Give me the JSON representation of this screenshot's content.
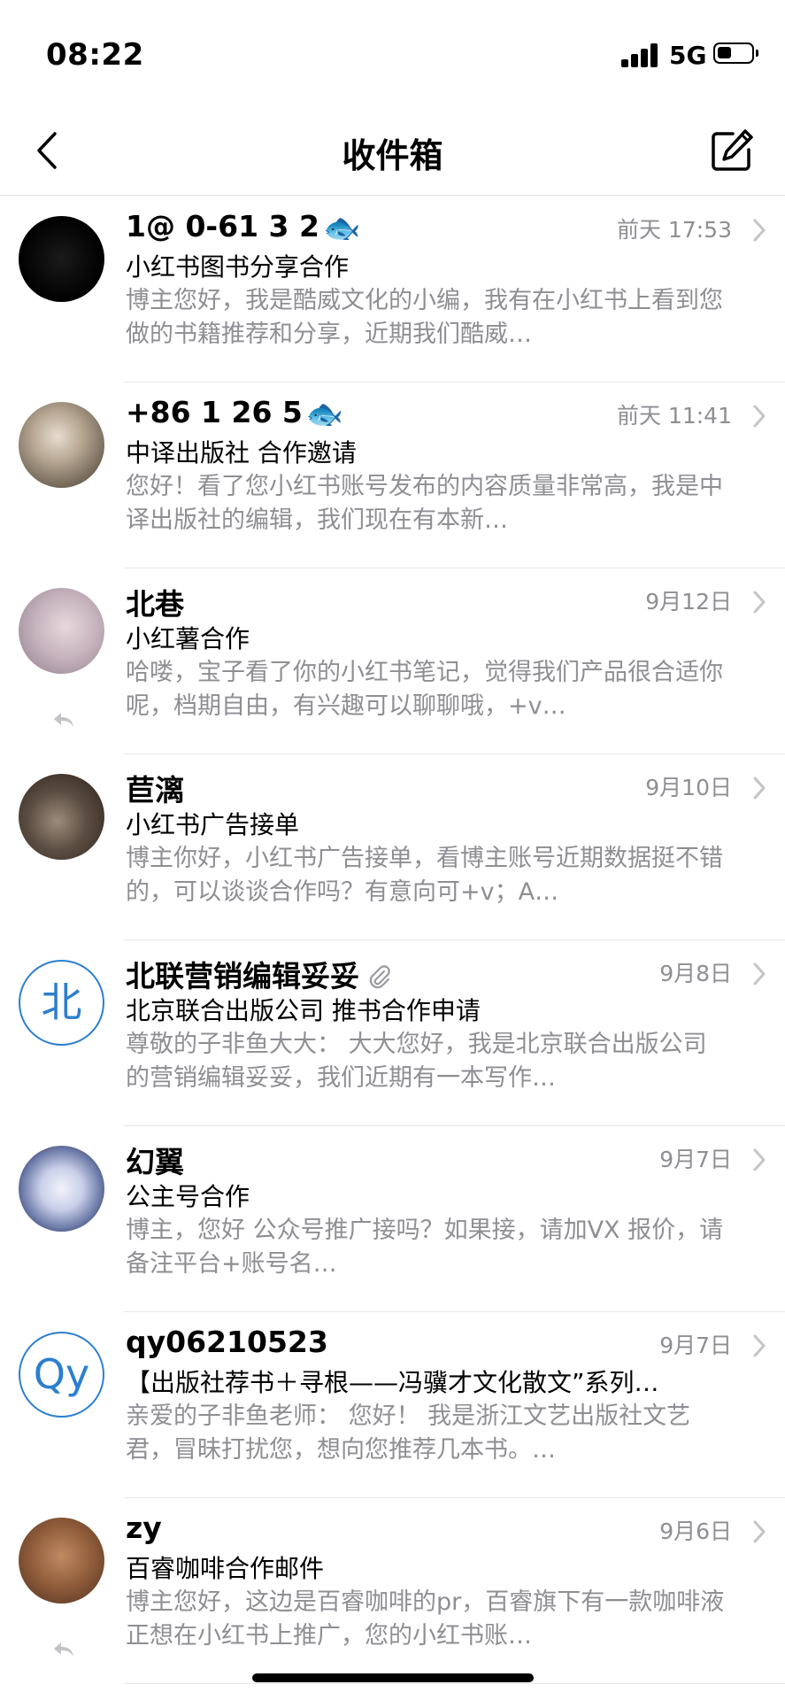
{
  "status_bar": {
    "time": "08:22",
    "network": "5G"
  },
  "nav": {
    "title": "收件箱"
  },
  "icons": {
    "back": "chevron-left-icon",
    "compose": "compose-icon",
    "reply": "reply-icon",
    "attachment": "paperclip-icon",
    "row_arrow": "chevron-right-icon"
  },
  "colors": {
    "accent": "#2c7fd0",
    "secondary_text": "#8e8e93"
  },
  "mails": [
    {
      "sender": "1@ 0-61 3 2",
      "sender_emoji": "🐟",
      "date": "前天 17:53",
      "subject": "小红书图书分享合作",
      "preview": "博主您好，我是酷威文化的小编，我有在小红书上看到您做的书籍推荐和分享，近期我们酷威…",
      "avatar": "black-photo",
      "replied": false,
      "attachment": false
    },
    {
      "sender": "+86 1 26 5",
      "sender_emoji": "🐟",
      "date": "前天 11:41",
      "subject": "中译出版社 合作邀请",
      "preview": "您好！看了您小红书账号发布的内容质量非常高，我是中译出版社的编辑，我们现在有本新…",
      "avatar": "photo-portrait",
      "replied": false,
      "attachment": false
    },
    {
      "sender": "北巷",
      "sender_emoji": "",
      "date": "9月12日",
      "subject": "小红薯合作",
      "preview": "哈喽，宝子看了你的小红书笔记，觉得我们产品很合适你呢，档期自由，有兴趣可以聊聊哦，+v…",
      "avatar": "photo-anime",
      "replied": true,
      "attachment": false
    },
    {
      "sender": "苣漓",
      "sender_emoji": "",
      "date": "9月10日",
      "subject": "小红书广告接单",
      "preview": "博主你好，小红书广告接单，看博主账号近期数据挺不错的，可以谈谈合作吗？有意向可+v；A…",
      "avatar": "photo-dark",
      "replied": false,
      "attachment": false
    },
    {
      "sender": "北联营销编辑妥妥",
      "sender_emoji": "",
      "date": "9月8日",
      "subject": "北京联合出版公司 推书合作申请",
      "preview": "尊敬的子非鱼大大：  大大您好，我是北京联合出版公司的营销编辑妥妥，我们近期有一本写作…",
      "avatar_letter": "北",
      "replied": false,
      "attachment": true
    },
    {
      "sender": "幻翼",
      "sender_emoji": "",
      "date": "9月7日",
      "subject": "公主号合作",
      "preview": "博主，您好 公众号推广接吗？如果接，请加VX  报价，请备注平台+账号名…",
      "avatar": "photo-wing",
      "replied": false,
      "attachment": false
    },
    {
      "sender": "qy06210523",
      "sender_emoji": "",
      "date": "9月7日",
      "subject": "【出版社荐书＋寻根——冯骥才文化散文”系列…",
      "preview": "亲爱的子非鱼老师：  您好！  我是浙江文艺出版社文艺君，冒昧打扰您，想向您推荐几本书。…",
      "avatar_letter": "Qy",
      "replied": false,
      "attachment": false
    },
    {
      "sender": "zy",
      "sender_emoji": "",
      "date": "9月6日",
      "subject": "百睿咖啡合作邮件",
      "preview": "博主您好，这边是百睿咖啡的pr，百睿旗下有一款咖啡液正想在小红书上推广，您的小红书账…",
      "avatar": "photo-dog",
      "replied": true,
      "attachment": false
    }
  ]
}
